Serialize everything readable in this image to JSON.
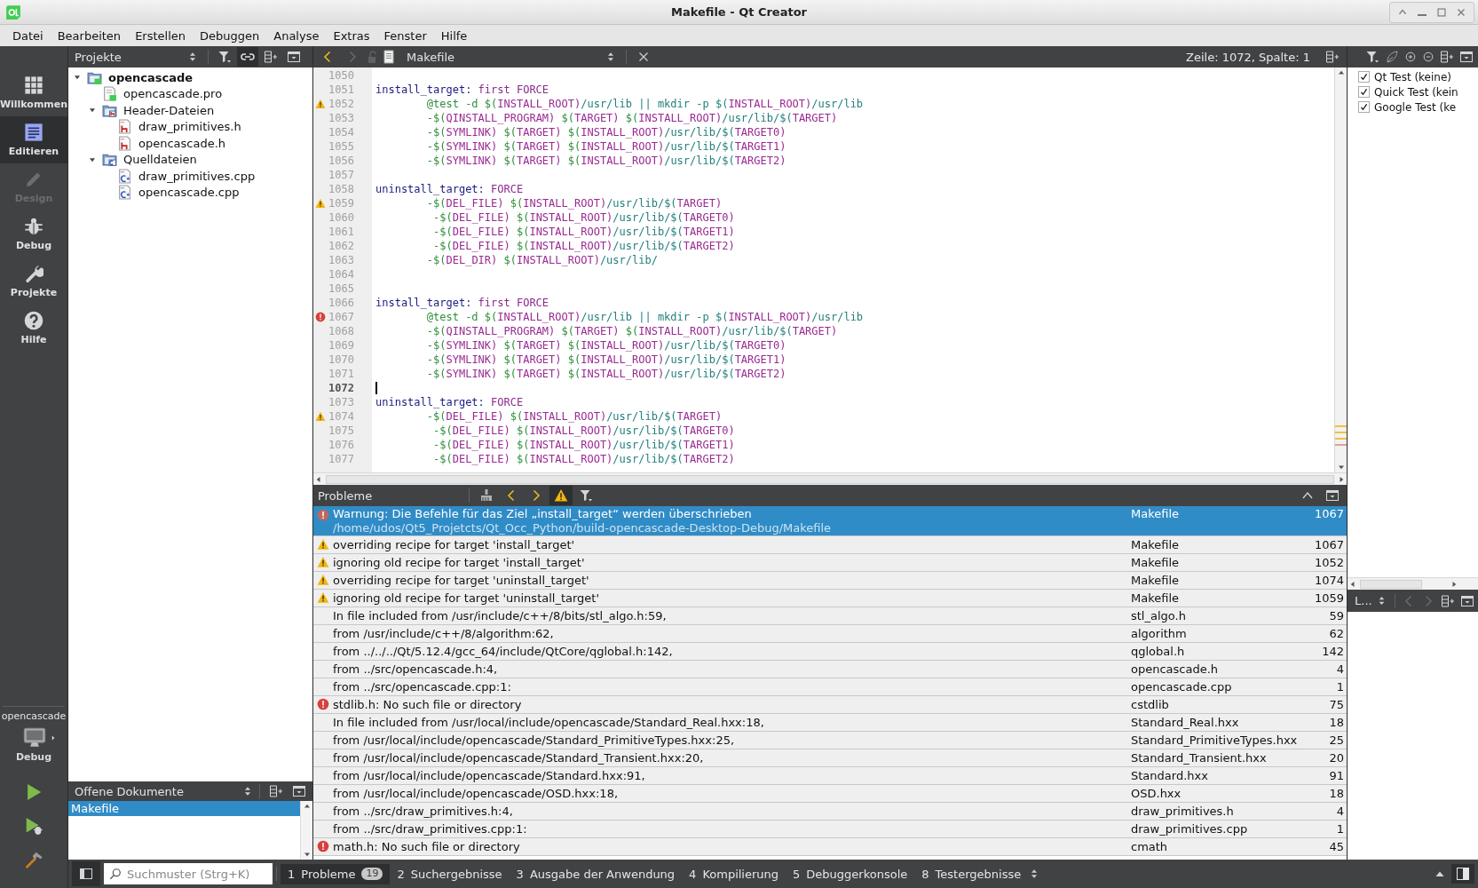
{
  "window": {
    "title": "Makefile - Qt Creator"
  },
  "menu": [
    "Datei",
    "Bearbeiten",
    "Erstellen",
    "Debuggen",
    "Analyse",
    "Extras",
    "Fenster",
    "Hilfe"
  ],
  "modes": [
    {
      "label": "Willkommen",
      "kind": "welcome",
      "selected": false,
      "disabled": false
    },
    {
      "label": "Editieren",
      "kind": "edit",
      "selected": true,
      "disabled": false
    },
    {
      "label": "Design",
      "kind": "design",
      "selected": false,
      "disabled": true
    },
    {
      "label": "Debug",
      "kind": "debug",
      "selected": false,
      "disabled": false
    },
    {
      "label": "Projekte",
      "kind": "projects",
      "selected": false,
      "disabled": false
    },
    {
      "label": "Hilfe",
      "kind": "help",
      "selected": false,
      "disabled": false
    }
  ],
  "kit": {
    "project": "opencascade",
    "build": "Debug"
  },
  "projects_panel": {
    "title": "Projekte",
    "tree": [
      {
        "label": "opencascade",
        "kind": "project",
        "expanded": true,
        "children": [
          {
            "label": "opencascade.pro",
            "kind": "pro"
          },
          {
            "label": "Header-Dateien",
            "kind": "folder-h",
            "expanded": true,
            "children": [
              {
                "label": "draw_primitives.h",
                "kind": "header"
              },
              {
                "label": "opencascade.h",
                "kind": "header"
              }
            ]
          },
          {
            "label": "Quelldateien",
            "kind": "folder-src",
            "expanded": true,
            "children": [
              {
                "label": "draw_primitives.cpp",
                "kind": "source"
              },
              {
                "label": "opencascade.cpp",
                "kind": "source"
              }
            ]
          }
        ]
      }
    ]
  },
  "open_documents": {
    "title": "Offene Dokumente",
    "items": [
      {
        "label": "Makefile",
        "selected": true
      }
    ]
  },
  "editor": {
    "file": "Makefile",
    "position": "Zeile: 1072, Spalte: 1",
    "lines": [
      {
        "number": "1050",
        "current": false
      },
      {
        "number": "1051",
        "current": false,
        "segments": [
          {
            "kind": "target",
            "text": "install_target:"
          },
          {
            "kind": "keyword",
            "text": " first FORCE"
          }
        ]
      },
      {
        "number": "1052",
        "current": false,
        "kind": "warning",
        "segments": [
          {
            "kind": "cmd",
            "text": "        @test -d $("
          },
          {
            "kind": "var",
            "text": "INSTALL_ROOT)"
          },
          {
            "kind": "path",
            "text": "/usr/lib || mkdir -p $("
          },
          {
            "kind": "var",
            "text": "INSTALL_ROOT)"
          },
          {
            "kind": "path",
            "text": "/usr/lib"
          }
        ]
      },
      {
        "number": "1053",
        "current": false,
        "segments": [
          {
            "kind": "cmd",
            "text": "        -$("
          },
          {
            "kind": "var",
            "text": "QINSTALL_PROGRAM)"
          },
          {
            "kind": "cmd",
            "text": " $("
          },
          {
            "kind": "var",
            "text": "TARGET)"
          },
          {
            "kind": "cmd",
            "text": " $("
          },
          {
            "kind": "var",
            "text": "INSTALL_ROOT)"
          },
          {
            "kind": "path",
            "text": "/usr/lib/$("
          },
          {
            "kind": "var",
            "text": "TARGET)"
          }
        ]
      },
      {
        "number": "1054",
        "current": false,
        "segments": [
          {
            "kind": "cmd",
            "text": "        -$("
          },
          {
            "kind": "var",
            "text": "SYMLINK)"
          },
          {
            "kind": "cmd",
            "text": " $("
          },
          {
            "kind": "var",
            "text": "TARGET)"
          },
          {
            "kind": "cmd",
            "text": " $("
          },
          {
            "kind": "var",
            "text": "INSTALL_ROOT)"
          },
          {
            "kind": "path",
            "text": "/usr/lib/$("
          },
          {
            "kind": "var",
            "text": "TARGET0)"
          }
        ]
      },
      {
        "number": "1055",
        "current": false,
        "segments": [
          {
            "kind": "cmd",
            "text": "        -$("
          },
          {
            "kind": "var",
            "text": "SYMLINK)"
          },
          {
            "kind": "cmd",
            "text": " $("
          },
          {
            "kind": "var",
            "text": "TARGET)"
          },
          {
            "kind": "cmd",
            "text": " $("
          },
          {
            "kind": "var",
            "text": "INSTALL_ROOT)"
          },
          {
            "kind": "path",
            "text": "/usr/lib/$("
          },
          {
            "kind": "var",
            "text": "TARGET1)"
          }
        ]
      },
      {
        "number": "1056",
        "current": false,
        "segments": [
          {
            "kind": "cmd",
            "text": "        -$("
          },
          {
            "kind": "var",
            "text": "SYMLINK)"
          },
          {
            "kind": "cmd",
            "text": " $("
          },
          {
            "kind": "var",
            "text": "TARGET)"
          },
          {
            "kind": "cmd",
            "text": " $("
          },
          {
            "kind": "var",
            "text": "INSTALL_ROOT)"
          },
          {
            "kind": "path",
            "text": "/usr/lib/$("
          },
          {
            "kind": "var",
            "text": "TARGET2)"
          }
        ]
      },
      {
        "number": "1057",
        "current": false
      },
      {
        "number": "1058",
        "current": false,
        "segments": [
          {
            "kind": "target",
            "text": "uninstall_target:"
          },
          {
            "kind": "keyword",
            "text": " FORCE"
          }
        ]
      },
      {
        "number": "1059",
        "current": false,
        "kind": "warning",
        "segments": [
          {
            "kind": "cmd",
            "text": "        -$("
          },
          {
            "kind": "var",
            "text": "DEL_FILE)"
          },
          {
            "kind": "cmd",
            "text": " $("
          },
          {
            "kind": "var",
            "text": "INSTALL_ROOT)"
          },
          {
            "kind": "path",
            "text": "/usr/lib/$("
          },
          {
            "kind": "var",
            "text": "TARGET)"
          }
        ]
      },
      {
        "number": "1060",
        "current": false,
        "segments": [
          {
            "kind": "cmd",
            "text": "         -$("
          },
          {
            "kind": "var",
            "text": "DEL_FILE)"
          },
          {
            "kind": "cmd",
            "text": " $("
          },
          {
            "kind": "var",
            "text": "INSTALL_ROOT)"
          },
          {
            "kind": "path",
            "text": "/usr/lib/$("
          },
          {
            "kind": "var",
            "text": "TARGET0)"
          }
        ]
      },
      {
        "number": "1061",
        "current": false,
        "segments": [
          {
            "kind": "cmd",
            "text": "         -$("
          },
          {
            "kind": "var",
            "text": "DEL_FILE)"
          },
          {
            "kind": "cmd",
            "text": " $("
          },
          {
            "kind": "var",
            "text": "INSTALL_ROOT)"
          },
          {
            "kind": "path",
            "text": "/usr/lib/$("
          },
          {
            "kind": "var",
            "text": "TARGET1)"
          }
        ]
      },
      {
        "number": "1062",
        "current": false,
        "segments": [
          {
            "kind": "cmd",
            "text": "         -$("
          },
          {
            "kind": "var",
            "text": "DEL_FILE)"
          },
          {
            "kind": "cmd",
            "text": " $("
          },
          {
            "kind": "var",
            "text": "INSTALL_ROOT)"
          },
          {
            "kind": "path",
            "text": "/usr/lib/$("
          },
          {
            "kind": "var",
            "text": "TARGET2)"
          }
        ]
      },
      {
        "number": "1063",
        "current": false,
        "segments": [
          {
            "kind": "cmd",
            "text": "        -$("
          },
          {
            "kind": "var",
            "text": "DEL_DIR)"
          },
          {
            "kind": "cmd",
            "text": " $("
          },
          {
            "kind": "var",
            "text": "INSTALL_ROOT)"
          },
          {
            "kind": "path",
            "text": "/usr/lib/"
          }
        ]
      },
      {
        "number": "1064",
        "current": false
      },
      {
        "number": "1065",
        "current": false
      },
      {
        "number": "1066",
        "current": false,
        "segments": [
          {
            "kind": "target",
            "text": "install_target:"
          },
          {
            "kind": "keyword",
            "text": " first FORCE"
          }
        ]
      },
      {
        "number": "1067",
        "current": false,
        "kind": "error",
        "segments": [
          {
            "kind": "cmd",
            "text": "        @test -d $("
          },
          {
            "kind": "var",
            "text": "INSTALL_ROOT)"
          },
          {
            "kind": "path",
            "text": "/usr/lib || mkdir -p $("
          },
          {
            "kind": "var",
            "text": "INSTALL_ROOT)"
          },
          {
            "kind": "path",
            "text": "/usr/lib"
          }
        ]
      },
      {
        "number": "1068",
        "current": false,
        "segments": [
          {
            "kind": "cmd",
            "text": "        -$("
          },
          {
            "kind": "var",
            "text": "QINSTALL_PROGRAM)"
          },
          {
            "kind": "cmd",
            "text": " $("
          },
          {
            "kind": "var",
            "text": "TARGET)"
          },
          {
            "kind": "cmd",
            "text": " $("
          },
          {
            "kind": "var",
            "text": "INSTALL_ROOT)"
          },
          {
            "kind": "path",
            "text": "/usr/lib/$("
          },
          {
            "kind": "var",
            "text": "TARGET)"
          }
        ]
      },
      {
        "number": "1069",
        "current": false,
        "segments": [
          {
            "kind": "cmd",
            "text": "        -$("
          },
          {
            "kind": "var",
            "text": "SYMLINK)"
          },
          {
            "kind": "cmd",
            "text": " $("
          },
          {
            "kind": "var",
            "text": "TARGET)"
          },
          {
            "kind": "cmd",
            "text": " $("
          },
          {
            "kind": "var",
            "text": "INSTALL_ROOT)"
          },
          {
            "kind": "path",
            "text": "/usr/lib/$("
          },
          {
            "kind": "var",
            "text": "TARGET0)"
          }
        ]
      },
      {
        "number": "1070",
        "current": false,
        "segments": [
          {
            "kind": "cmd",
            "text": "        -$("
          },
          {
            "kind": "var",
            "text": "SYMLINK)"
          },
          {
            "kind": "cmd",
            "text": " $("
          },
          {
            "kind": "var",
            "text": "TARGET)"
          },
          {
            "kind": "cmd",
            "text": " $("
          },
          {
            "kind": "var",
            "text": "INSTALL_ROOT)"
          },
          {
            "kind": "path",
            "text": "/usr/lib/$("
          },
          {
            "kind": "var",
            "text": "TARGET1)"
          }
        ]
      },
      {
        "number": "1071",
        "current": false,
        "segments": [
          {
            "kind": "cmd",
            "text": "        -$("
          },
          {
            "kind": "var",
            "text": "SYMLINK)"
          },
          {
            "kind": "cmd",
            "text": " $("
          },
          {
            "kind": "var",
            "text": "TARGET)"
          },
          {
            "kind": "cmd",
            "text": " $("
          },
          {
            "kind": "var",
            "text": "INSTALL_ROOT)"
          },
          {
            "kind": "path",
            "text": "/usr/lib/$("
          },
          {
            "kind": "var",
            "text": "TARGET2)"
          }
        ]
      },
      {
        "number": "1072",
        "current": true
      },
      {
        "number": "1073",
        "current": false,
        "segments": [
          {
            "kind": "target",
            "text": "uninstall_target:"
          },
          {
            "kind": "keyword",
            "text": " FORCE"
          }
        ]
      },
      {
        "number": "1074",
        "current": false,
        "kind": "warning",
        "segments": [
          {
            "kind": "cmd",
            "text": "        -$("
          },
          {
            "kind": "var",
            "text": "DEL_FILE)"
          },
          {
            "kind": "cmd",
            "text": " $("
          },
          {
            "kind": "var",
            "text": "INSTALL_ROOT)"
          },
          {
            "kind": "path",
            "text": "/usr/lib/$("
          },
          {
            "kind": "var",
            "text": "TARGET)"
          }
        ]
      },
      {
        "number": "1075",
        "current": false,
        "segments": [
          {
            "kind": "cmd",
            "text": "         -$("
          },
          {
            "kind": "var",
            "text": "DEL_FILE)"
          },
          {
            "kind": "cmd",
            "text": " $("
          },
          {
            "kind": "var",
            "text": "INSTALL_ROOT)"
          },
          {
            "kind": "path",
            "text": "/usr/lib/$("
          },
          {
            "kind": "var",
            "text": "TARGET0)"
          }
        ]
      },
      {
        "number": "1076",
        "current": false,
        "segments": [
          {
            "kind": "cmd",
            "text": "         -$("
          },
          {
            "kind": "var",
            "text": "DEL_FILE)"
          },
          {
            "kind": "cmd",
            "text": " $("
          },
          {
            "kind": "var",
            "text": "INSTALL_ROOT)"
          },
          {
            "kind": "path",
            "text": "/usr/lib/$("
          },
          {
            "kind": "var",
            "text": "TARGET1)"
          }
        ]
      },
      {
        "number": "1077",
        "current": false,
        "segments": [
          {
            "kind": "cmd",
            "text": "         -$("
          },
          {
            "kind": "var",
            "text": "DEL_FILE)"
          },
          {
            "kind": "cmd",
            "text": " $("
          },
          {
            "kind": "var",
            "text": "INSTALL_ROOT)"
          },
          {
            "kind": "path",
            "text": "/usr/lib/$("
          },
          {
            "kind": "var",
            "text": "TARGET2)"
          }
        ]
      }
    ]
  },
  "problems": {
    "title": "Probleme",
    "warnings_filter_on": true,
    "rows": [
      {
        "kind": "error",
        "text": "Warnung: Die Befehle für das Ziel „install_target“ werden überschrieben",
        "detail": "/home/udos/Qt5_Projetcts/Qt_Occ_Python/build-opencascade-Desktop-Debug/Makefile",
        "file": "Makefile",
        "line": "1067",
        "selected": true
      },
      {
        "kind": "warning",
        "text": "overriding recipe for target 'install_target'",
        "file": "Makefile",
        "line": "1067",
        "selected": false
      },
      {
        "kind": "warning",
        "text": "ignoring old recipe for target 'install_target'",
        "file": "Makefile",
        "line": "1052",
        "selected": false
      },
      {
        "kind": "warning",
        "text": "overriding recipe for target 'uninstall_target'",
        "file": "Makefile",
        "line": "1074",
        "selected": false
      },
      {
        "kind": "warning",
        "text": "ignoring old recipe for target 'uninstall_target'",
        "file": "Makefile",
        "line": "1059",
        "selected": false
      },
      {
        "text": "In file included from /usr/include/c++/8/bits/stl_algo.h:59,",
        "file": "stl_algo.h",
        "line": "59",
        "selected": false
      },
      {
        "text": "from /usr/include/c++/8/algorithm:62,",
        "file": "algorithm",
        "line": "62",
        "selected": false
      },
      {
        "text": "from ../../../Qt/5.12.4/gcc_64/include/QtCore/qglobal.h:142,",
        "file": "qglobal.h",
        "line": "142",
        "selected": false
      },
      {
        "text": "from ../src/opencascade.h:4,",
        "file": "opencascade.h",
        "line": "4",
        "selected": false
      },
      {
        "text": "from ../src/opencascade.cpp:1:",
        "file": "opencascade.cpp",
        "line": "1",
        "selected": false
      },
      {
        "kind": "error",
        "text": "stdlib.h: No such file or directory",
        "file": "cstdlib",
        "line": "75",
        "selected": false
      },
      {
        "text": "In file included from /usr/local/include/opencascade/Standard_Real.hxx:18,",
        "file": "Standard_Real.hxx",
        "line": "18",
        "selected": false
      },
      {
        "text": "from /usr/local/include/opencascade/Standard_PrimitiveTypes.hxx:25,",
        "file": "Standard_PrimitiveTypes.hxx",
        "line": "25",
        "selected": false
      },
      {
        "text": "from /usr/local/include/opencascade/Standard_Transient.hxx:20,",
        "file": "Standard_Transient.hxx",
        "line": "20",
        "selected": false
      },
      {
        "text": "from /usr/local/include/opencascade/Standard.hxx:91,",
        "file": "Standard.hxx",
        "line": "91",
        "selected": false
      },
      {
        "text": "from /usr/local/include/opencascade/OSD.hxx:18,",
        "file": "OSD.hxx",
        "line": "18",
        "selected": false
      },
      {
        "text": "from ../src/draw_primitives.h:4,",
        "file": "draw_primitives.h",
        "line": "4",
        "selected": false
      },
      {
        "text": "from ../src/draw_primitives.cpp:1:",
        "file": "draw_primitives.cpp",
        "line": "1",
        "selected": false
      },
      {
        "kind": "error",
        "text": "math.h: No such file or directory",
        "file": "cmath",
        "line": "45",
        "selected": false
      }
    ]
  },
  "test_panel": {
    "items": [
      {
        "label": "Qt Test (keine)",
        "checked": true
      },
      {
        "label": "Quick Test (kein",
        "checked": true
      },
      {
        "label": "Google Test (ke",
        "checked": true
      }
    ],
    "selector": "L..."
  },
  "bottom_bar": {
    "search": {
      "placeholder": "Suchmuster (Strg+K)"
    },
    "tabs": [
      {
        "number": "1",
        "label": "Probleme",
        "badge": "19",
        "selected": true
      },
      {
        "number": "2",
        "label": "Suchergebnisse",
        "selected": false
      },
      {
        "number": "3",
        "label": "Ausgabe der Anwendung",
        "selected": false
      },
      {
        "number": "4",
        "label": "Kompilierung",
        "selected": false
      },
      {
        "number": "5",
        "label": "Debuggerkonsole",
        "selected": false
      },
      {
        "number": "8",
        "label": "Testergebnisse",
        "selected": false
      }
    ]
  }
}
